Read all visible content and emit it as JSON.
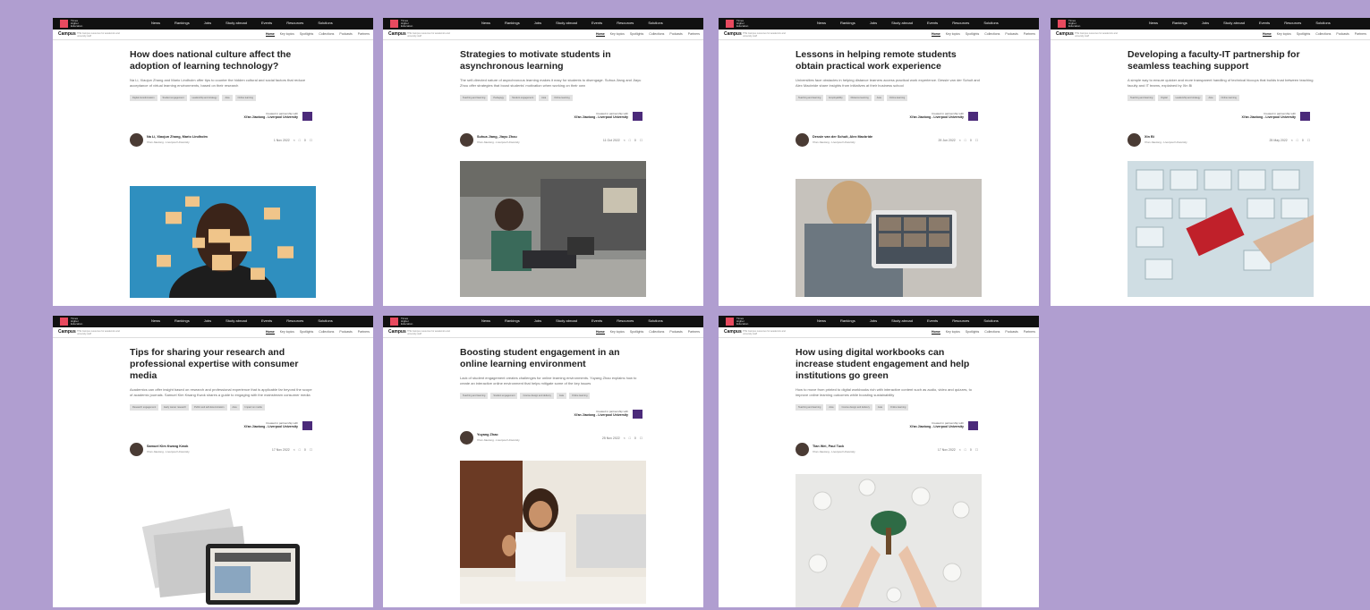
{
  "colors": {
    "background": "#b09ed0",
    "accent": "#e84a5f",
    "partner_logo": "#4b2a7a",
    "header": "#111111"
  },
  "header": {
    "logo_text": "Times Higher Education",
    "nav": [
      "News",
      "Rankings",
      "Jobs",
      "Study abroad",
      "Events",
      "Resources",
      "Solutions"
    ],
    "campus": "Campus",
    "campus_sub": "THE Campus resources for academics and university staff",
    "sections": [
      "Home",
      "Key topics",
      "Spotlights",
      "Collections",
      "Podcasts",
      "Partners"
    ]
  },
  "partner": {
    "line1": "Created in partnership with",
    "line2": "Xi'an Jiaotong - Liverpool University"
  },
  "articles": [
    {
      "title": "How does national culture affect the adoption of learning technology?",
      "standfirst": "Na Li, Xiaojun Zhang and Mario Lindholm offer tips to counter the hidden cultural and social factors that reduce acceptance of virtual learning environments, based on their research",
      "tags": [
        "Digital transformation",
        "Student engagement",
        "Leadership and strategy",
        "Asia",
        "Online learning"
      ],
      "author": "Na Li, Xiaojun Zhang, Mario Lindholm",
      "affiliation": "Xi'an Jiaotong - Liverpool University",
      "date": "1 Nov 2022",
      "comments": "0",
      "image": "sticky-notes-face"
    },
    {
      "title": "Strategies to motivate students in asynchronous learning",
      "standfirst": "The self-directed nature of asynchronous learning makes it easy for students to disengage. Suhua Jiang and Jiayu Zhou offer strategies that boost students' motivation when working on their own",
      "tags": [
        "Teaching and learning",
        "Pedagogy",
        "Student engagement",
        "Asia",
        "Online learning"
      ],
      "author": "Suhua Jiang, Jiayu Zhou",
      "affiliation": "Xi'an Jiaotong - Liverpool University",
      "date": "11 Oct 2022",
      "comments": "0",
      "image": "student-laptop-couch"
    },
    {
      "title": "Lessons in helping remote students obtain practical work experience",
      "standfirst": "Universities face obstacles in helping distance learners access practical work experience. Dessie van der Schuit and Alex Macbride share insights from initiatives at their business school",
      "tags": [
        "Teaching and learning",
        "Employability",
        "Distance learning",
        "Asia",
        "Online learning"
      ],
      "author": "Dessie van der Schuit, Alex Macbride",
      "affiliation": "Xi'an Jiaotong - Liverpool University",
      "date": "29 Jun 2022",
      "comments": "0",
      "image": "video-call-tablet"
    },
    {
      "title": "Developing a faculty-IT partnership for seamless teaching support",
      "standfirst": "A simple way to ensure quicker and more transparent handling of technical hiccups that builds trust between teaching faculty and IT teams, explained by Xin Bi",
      "tags": [
        "Teaching and learning",
        "Digital",
        "Leadership and strategy",
        "Asia",
        "Online learning"
      ],
      "author": "Xin Bi",
      "affiliation": "Xi'an Jiaotong - Liverpool University",
      "date": "25 May 2022",
      "comments": "0",
      "image": "help-key-keyboard"
    },
    {
      "title": "Tips for sharing your research and professional expertise with consumer media",
      "standfirst": "Academics can offer insight based on research and professional experience that is applicable far beyond the scope of academic journals. Samuel Kim Kwang Kwok shares a guide to engaging with the mainstream consumer media",
      "tags": [
        "Research engagement",
        "Early career research",
        "Public and self-determination",
        "Asia",
        "Impact on media"
      ],
      "author": "Samuel Kim Kwang Kwok",
      "affiliation": "Xi'an Jiaotong - Liverpool University",
      "date": "17 Nov 2022",
      "comments": "0",
      "image": "newspapers-tablet"
    },
    {
      "title": "Boosting student engagement in an online learning environment",
      "standfirst": "Lack of student engagement creates challenges for online learning environments. Yuyang Zhao explains how to create an interactive online environment that helps mitigate some of the key issues",
      "tags": [
        "Teaching and learning",
        "Student engagement",
        "Course design and delivery",
        "Asia",
        "Online learning"
      ],
      "author": "Yuyang Zhao",
      "affiliation": "Xi'an Jiaotong - Liverpool University",
      "date": "25 Nov 2022",
      "comments": "0",
      "image": "student-waving-laptop"
    },
    {
      "title": "How using digital workbooks can increase student engagement and help institutions go green",
      "standfirst": "How to move from printed to digital workbooks rich with interactive content such as audio, video and quizzes, to improve online learning outcomes while boosting sustainability",
      "tags": [
        "Teaching and learning",
        "Asia",
        "Course design and delivery",
        "Asia",
        "Online learning"
      ],
      "author": "Tian Wei, Paul Tuck",
      "affiliation": "Xi'an Jiaotong - Liverpool University",
      "date": "17 Nov 2022",
      "comments": "0",
      "image": "hands-paper-tree"
    }
  ]
}
